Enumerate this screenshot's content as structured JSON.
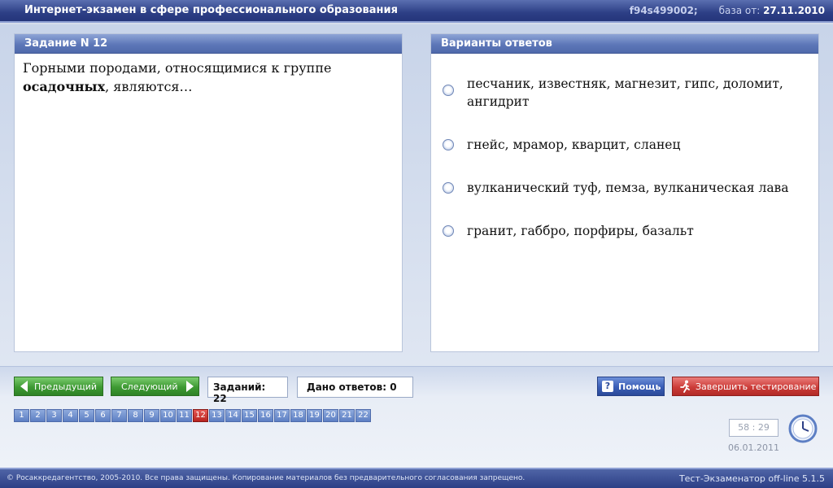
{
  "header": {
    "title": "Интернет-экзамен в сфере профессионального образования",
    "code": "f94s499002;",
    "base_label": "база от:",
    "base_date": "27.11.2010"
  },
  "task": {
    "heading": "Задание N 12",
    "question_prefix": "Горными породами, относящимися к группе",
    "question_bold": "осадочных",
    "question_suffix": ", являются…"
  },
  "answers": {
    "heading": "Варианты ответов",
    "options": [
      "песчаник, известняк, магнезит, гипс, доломит, ангидрит",
      "гнейс, мрамор, кварцит, сланец",
      "вулканический туф, пемза, вулканическая лава",
      "гранит, габбро, порфиры, базальт"
    ]
  },
  "nav": {
    "prev_label": "Предыдущий",
    "next_label": "Следующий",
    "total_label": "Заданий: 22",
    "answered_label": "Дано ответов: 0",
    "help_label": "Помощь",
    "finish_label": "Завершить тестирование",
    "pages": [
      "1",
      "2",
      "3",
      "4",
      "5",
      "6",
      "7",
      "8",
      "9",
      "10",
      "11",
      "12",
      "13",
      "14",
      "15",
      "16",
      "17",
      "18",
      "19",
      "20",
      "21",
      "22"
    ],
    "current_page": "12",
    "timer": "58 : 29",
    "today": "06.01.2011"
  },
  "footer": {
    "copyright": "© Росаккредагентство, 2005-2010. Все права защищены. Копирование материалов без предварительного согласования запрещено.",
    "version": "Тест-Экзаменатор off-line 5.1.5"
  },
  "colors": {
    "header_bg": "#2d3f86",
    "panel_head": "#5d77b8",
    "green_button": "#3e9a33",
    "help_button": "#3a5eb6",
    "finish_button": "#cc3d39",
    "active_page": "#b8231f"
  }
}
